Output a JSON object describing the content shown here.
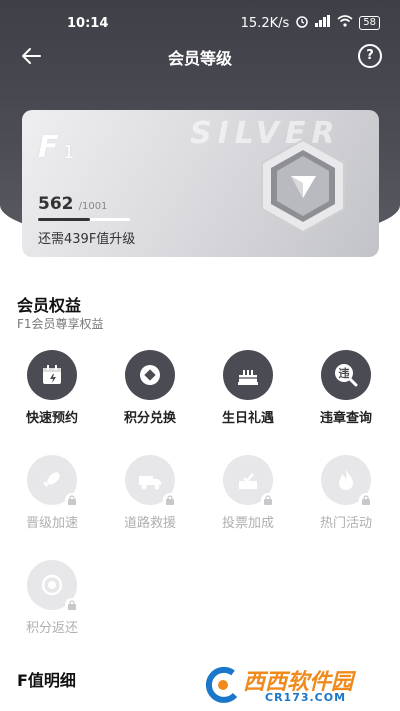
{
  "status_bar": {
    "time": "10:14",
    "speed": "15.2K/s",
    "battery": "58"
  },
  "nav": {
    "title": "会员等级",
    "help": "?"
  },
  "card": {
    "watermark": "SILVER",
    "level_letter": "F",
    "level_number": "1",
    "points_current": "562",
    "points_max": "/1001",
    "progress_fraction": 0.56,
    "need_text": "还需439F值升级"
  },
  "benefits_section": {
    "title": "会员权益",
    "subtitle": "F1会员尊享权益",
    "items": [
      {
        "label": "快速预约",
        "icon": "calendar-icon",
        "enabled": true
      },
      {
        "label": "积分兑换",
        "icon": "coin-icon",
        "enabled": true
      },
      {
        "label": "生日礼遇",
        "icon": "cake-icon",
        "enabled": true
      },
      {
        "label": "违章查询",
        "icon": "violation-search-icon",
        "enabled": true
      },
      {
        "label": "晋级加速",
        "icon": "rocket-icon",
        "enabled": false
      },
      {
        "label": "道路救援",
        "icon": "tow-truck-icon",
        "enabled": false
      },
      {
        "label": "投票加成",
        "icon": "vote-icon",
        "enabled": false
      },
      {
        "label": "热门活动",
        "icon": "flame-icon",
        "enabled": false
      },
      {
        "label": "积分返还",
        "icon": "points-return-icon",
        "enabled": false
      }
    ]
  },
  "detail_section": {
    "title": "F值明细"
  },
  "site_watermark": {
    "brand": "西西软件园",
    "domain": "CR173.COM"
  },
  "colors": {
    "header": "#45464e",
    "icon_active": "#4a4b53",
    "icon_locked": "#e7e7e9"
  }
}
